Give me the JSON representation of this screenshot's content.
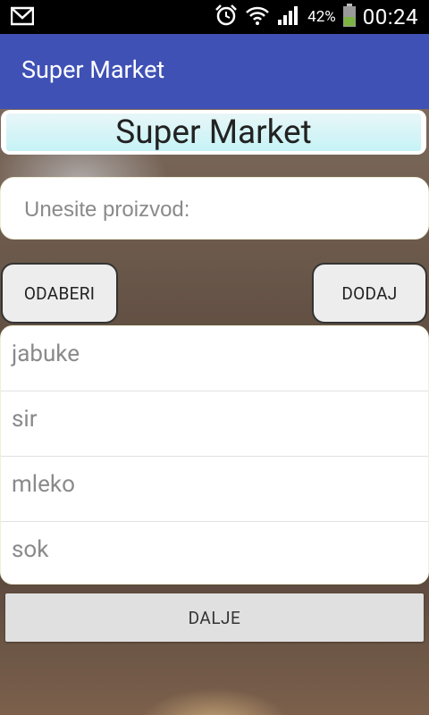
{
  "status_bar": {
    "battery_percent": "42%",
    "time": "00:24",
    "icons": [
      "gmail-icon",
      "alarm-icon",
      "wifi-icon",
      "signal-icon",
      "battery-icon"
    ]
  },
  "app_bar": {
    "title": "Super Market",
    "color": "#3f51b5"
  },
  "header": {
    "title": "Super Market"
  },
  "product_input": {
    "placeholder": "Unesite proizvod:",
    "value": ""
  },
  "buttons": {
    "select_label": "ODABERI",
    "add_label": "DODAJ",
    "next_label": "DALJE"
  },
  "list": {
    "items": [
      {
        "label": "jabuke"
      },
      {
        "label": "sir"
      },
      {
        "label": "mleko"
      },
      {
        "label": "sok"
      }
    ]
  }
}
